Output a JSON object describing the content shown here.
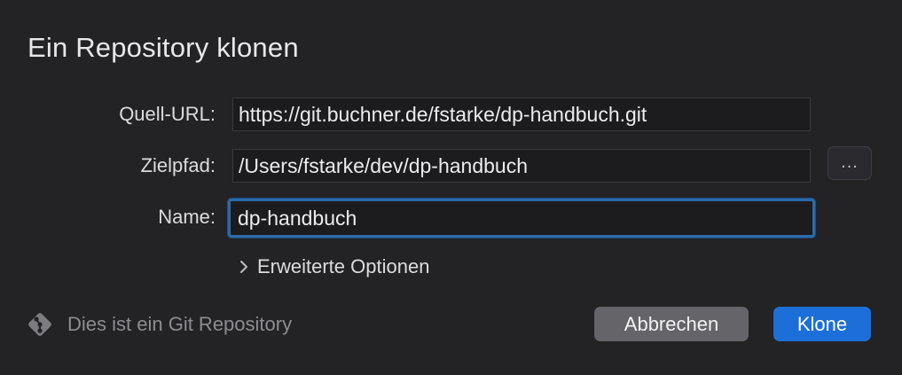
{
  "dialog": {
    "title": "Ein Repository klonen"
  },
  "form": {
    "source_url_label": "Quell-URL:",
    "source_url_value": "https://git.buchner.de/fstarke/dp-handbuch.git",
    "target_path_label": "Zielpfad:",
    "target_path_value": "/Users/fstarke/dev/dp-handbuch",
    "browse_label": "...",
    "name_label": "Name:",
    "name_value": "dp-handbuch"
  },
  "advanced": {
    "label": "Erweiterte Optionen",
    "expanded": false
  },
  "footer": {
    "info_text": "Dies ist ein Git Repository",
    "info_icon": "git-icon",
    "cancel_label": "Abbrechen",
    "confirm_label": "Klone"
  },
  "colors": {
    "background": "#232225",
    "accent": "#1c6fd9",
    "focus_ring": "#2c6aa8"
  }
}
